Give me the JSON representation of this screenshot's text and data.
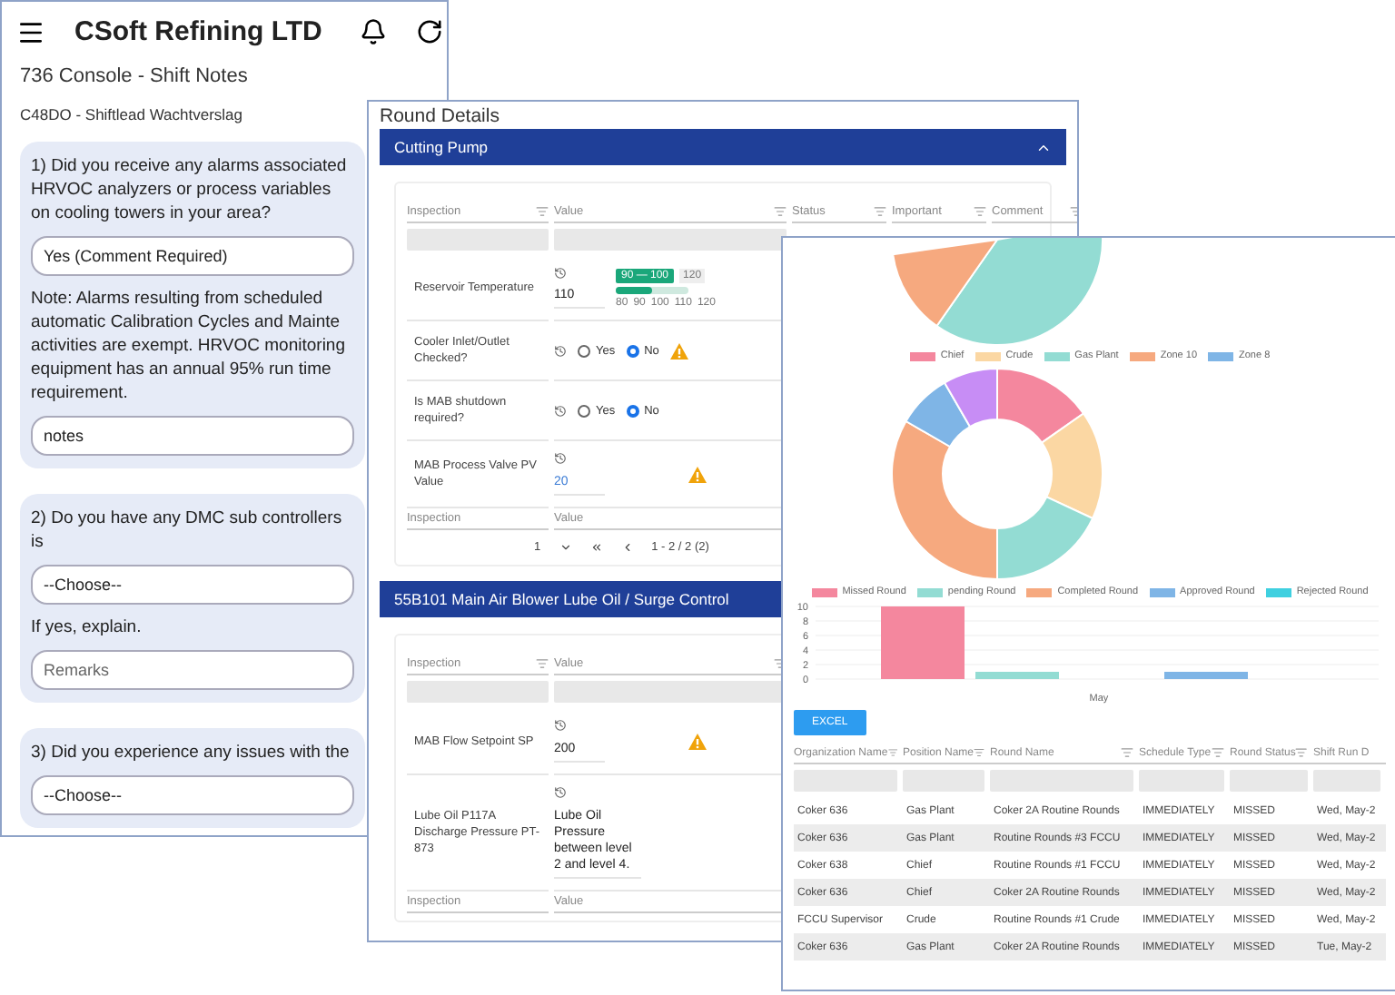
{
  "left_window": {
    "app_title": "CSoft Refining LTD",
    "page_title": "736 Console - Shift Notes",
    "form_title": "C48DO - Shiftlead Wachtverslag",
    "questions": [
      {
        "text": "1) Did you receive any alarms associated HRVOC analyzers or process variables on cooling towers in your area?",
        "items": [
          {
            "kind": "select",
            "value": "Yes (Comment Required)"
          },
          {
            "kind": "note",
            "text": "Note: Alarms resulting from scheduled automatic Calibration Cycles and Mainte activities are exempt. HRVOC monitoring equipment has an annual 95% run time requirement."
          },
          {
            "kind": "input",
            "value": "notes"
          }
        ]
      },
      {
        "text": "2) Do you have any DMC sub controllers is",
        "items": [
          {
            "kind": "select",
            "value": "--Choose--"
          },
          {
            "kind": "note",
            "text": "If yes, explain."
          },
          {
            "kind": "input",
            "placeholder": "Remarks"
          }
        ]
      },
      {
        "text": "3) Did you experience any issues with the",
        "items": [
          {
            "kind": "select",
            "value": "--Choose--"
          }
        ]
      }
    ]
  },
  "round_details": {
    "title": "Round Details",
    "sections": [
      {
        "title": "Cutting Pump",
        "expanded": true,
        "columns": [
          "Inspection",
          "Value",
          "Status",
          "Important",
          "Comment"
        ],
        "rows": [
          {
            "kind": "slider",
            "inspection": "Reservoir Temperature",
            "value": "110",
            "tooltip": "90 — 100",
            "max_label": "120",
            "ticks": [
              "80",
              "90",
              "100",
              "110",
              "120"
            ],
            "level": 0.5
          },
          {
            "kind": "radio",
            "inspection": "Cooler Inlet/Outlet Checked?",
            "options": [
              {
                "label": "Yes",
                "selected": false
              },
              {
                "label": "No",
                "selected": true
              }
            ],
            "warning": true
          },
          {
            "kind": "radio",
            "inspection": "Is MAB shutdown required?",
            "options": [
              {
                "label": "Yes",
                "selected": false
              },
              {
                "label": "No",
                "selected": true
              }
            ],
            "warning": false
          },
          {
            "kind": "number",
            "inspection": "MAB Process Valve PV Value",
            "value": "20",
            "warning": true
          }
        ],
        "footer_columns": [
          "Inspection",
          "Value"
        ],
        "pager": {
          "page": "1",
          "range": "1 - 2 / 2 (2)"
        }
      },
      {
        "title": "55B101 Main Air Blower Lube Oil / Surge Control",
        "columns": [
          "Inspection",
          "Value"
        ],
        "rows": [
          {
            "kind": "number",
            "inspection": "MAB Flow Setpoint SP",
            "value": "200",
            "warning": true
          },
          {
            "kind": "text",
            "inspection": "Lube Oil P117A Discharge Pressure PT-873",
            "value": "Lube Oil Pressure between level 2 and level 4.",
            "warning": false
          }
        ],
        "footer_columns": [
          "Inspection",
          "Value"
        ]
      }
    ]
  },
  "dashboard": {
    "position_legend": [
      {
        "label": "Chief",
        "color": "#f4879e"
      },
      {
        "label": "Crude",
        "color": "#fbd7a3"
      },
      {
        "label": "Gas Plant",
        "color": "#93dcd3"
      },
      {
        "label": "Zone 10",
        "color": "#f6a97f"
      },
      {
        "label": "Zone 8",
        "color": "#7fb5e6"
      }
    ],
    "status_chart": {
      "chart_data": {
        "type": "bar",
        "categories": [
          "May"
        ],
        "series": [
          {
            "name": "Missed Round",
            "color": "#f4879e",
            "values": [
              10
            ]
          },
          {
            "name": "pending Round",
            "color": "#93dcd3",
            "values": [
              1
            ]
          },
          {
            "name": "Completed Round",
            "color": "#f6a97f",
            "values": [
              0
            ]
          },
          {
            "name": "Approved Round",
            "color": "#7fb5e6",
            "values": [
              1
            ]
          },
          {
            "name": "Rejected Round",
            "color": "#3fd0e0",
            "values": [
              0
            ]
          }
        ],
        "ylim": [
          0,
          10
        ],
        "yticks": [
          0,
          2,
          4,
          6,
          8,
          10
        ],
        "grid": true,
        "legend": true
      }
    },
    "export_button": "EXCEL",
    "table": {
      "columns": [
        "Organization Name",
        "Position Name",
        "Round Name",
        "Schedule Type",
        "Round Status",
        "Shift Run D"
      ],
      "rows": [
        [
          "Coker 636",
          "Gas Plant",
          "Coker 2A Routine Rounds",
          "IMMEDIATELY",
          "MISSED",
          "Wed, May-2"
        ],
        [
          "Coker 636",
          "Gas Plant",
          "Routine Rounds #3 FCCU",
          "IMMEDIATELY",
          "MISSED",
          "Wed, May-2"
        ],
        [
          "Coker 638",
          "Chief",
          "Routine Rounds #1 FCCU",
          "IMMEDIATELY",
          "MISSED",
          "Wed, May-2"
        ],
        [
          "Coker 636",
          "Chief",
          "Coker 2A Routine Rounds",
          "IMMEDIATELY",
          "MISSED",
          "Wed, May-2"
        ],
        [
          "FCCU Supervisor",
          "Crude",
          "Routine Rounds #1 Crude",
          "IMMEDIATELY",
          "MISSED",
          "Wed, May-2"
        ],
        [
          "Coker 636",
          "Gas Plant",
          "Coker 2A Routine Rounds",
          "IMMEDIATELY",
          "MISSED",
          "Tue, May-2"
        ]
      ]
    }
  }
}
